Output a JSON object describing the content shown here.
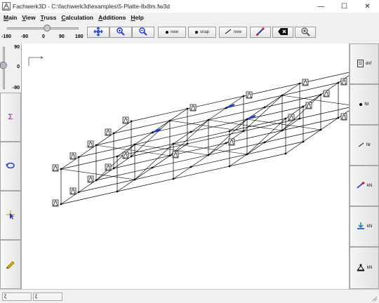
{
  "window": {
    "title": "Fachwerk3D - C:\\fachwerk3d\\examples\\5-Platte-8x8m.fw3d",
    "minimize": "—",
    "maximize": "☐",
    "close": "✕"
  },
  "menu": {
    "items": [
      {
        "first": "M",
        "rest": "ain"
      },
      {
        "first": "V",
        "rest": "iew"
      },
      {
        "first": "T",
        "rest": "russ"
      },
      {
        "first": "C",
        "rest": "alculation"
      },
      {
        "first": "A",
        "rest": "dditions"
      },
      {
        "first": "H",
        "rest": "elp"
      }
    ]
  },
  "toolbar": {
    "h_slider": {
      "ticks": [
        "-180",
        "-90",
        "0",
        "90",
        "180"
      ],
      "value": 0.57
    },
    "new_node_label": "new",
    "snap_label": "snap",
    "new_member_label": "new"
  },
  "left_panel": {
    "v_slider": {
      "top": "90",
      "middle": "0",
      "bottom": "-90",
      "value": 0.4
    },
    "sigma_glyph": "Σ"
  },
  "right_panel": {
    "dxf_label": "dxf",
    "nodes_label": "Nr",
    "members_label": "Nr",
    "loads_label": "kN",
    "supports_label": "kN",
    "reactions_label": "kN"
  },
  "status": {
    "field1": "ξ",
    "field2": "ξ"
  },
  "colors": {
    "accent_blue": "#1b3fd0",
    "member": "#000000"
  }
}
